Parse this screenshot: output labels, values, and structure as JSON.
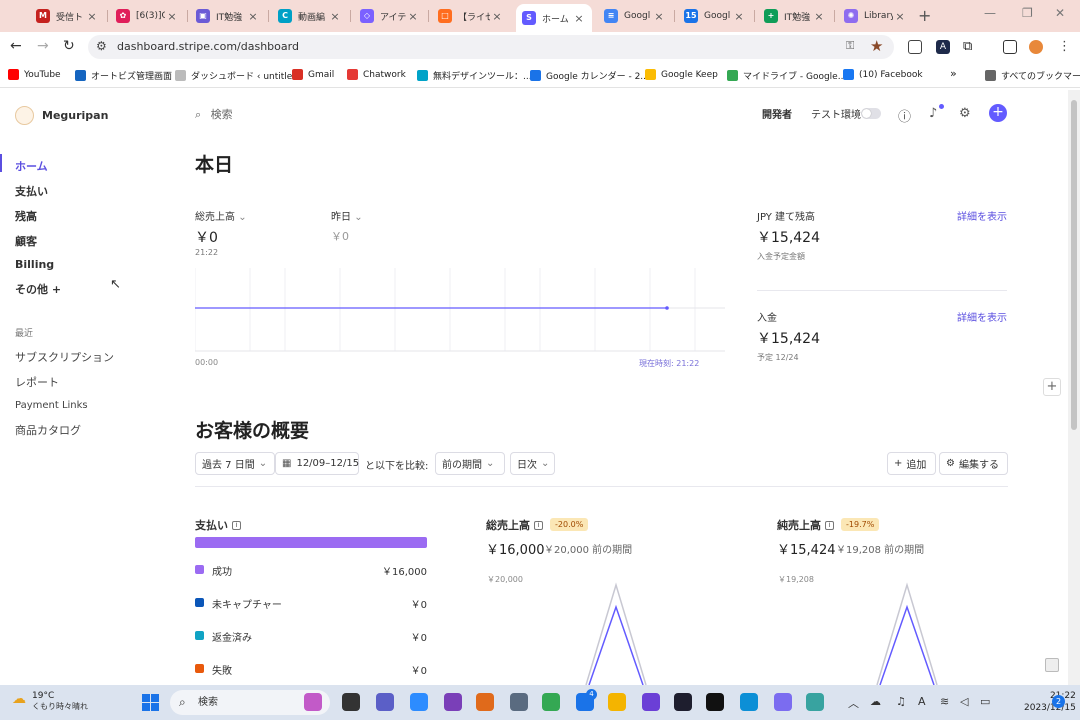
{
  "browser": {
    "tabs": [
      {
        "title": "受信トレ",
        "color": "#c5221f",
        "glyph": "M"
      },
      {
        "title": "[6(3)]C",
        "color": "#e01e5a",
        "glyph": "✿"
      },
      {
        "title": "IT勉強",
        "color": "#6b5bd6",
        "glyph": "▣"
      },
      {
        "title": "動画編",
        "color": "#00a0c6",
        "glyph": "C"
      },
      {
        "title": "アイテム",
        "color": "#7b61ff",
        "glyph": "◇"
      },
      {
        "title": "【ライセ",
        "color": "#ff6d1f",
        "glyph": "□"
      },
      {
        "title": "ホーム -",
        "color": "#635bff",
        "glyph": "S"
      },
      {
        "title": "Googl",
        "color": "#4285f4",
        "glyph": "≡"
      },
      {
        "title": "Googl",
        "color": "#1a73e8",
        "glyph": "15"
      },
      {
        "title": "IT勉強",
        "color": "#0f9d58",
        "glyph": "+"
      },
      {
        "title": "Library",
        "color": "#8e6cef",
        "glyph": "✺"
      }
    ],
    "address": {
      "url": "dashboard.stripe.com/dashboard"
    },
    "bookmarks": [
      {
        "label": "YouTube",
        "color": "#ff0000"
      },
      {
        "label": "オートビズ管理画面",
        "color": "#1565c0"
      },
      {
        "label": "ダッシュボード ‹ untitle...",
        "color": "#bbbbbb"
      },
      {
        "label": "Gmail",
        "color": "#d93025"
      },
      {
        "label": "Chatwork",
        "color": "#e53935"
      },
      {
        "label": "無料デザインツール：...",
        "color": "#00a3c8"
      },
      {
        "label": "Google カレンダー - 2...",
        "color": "#1a73e8"
      },
      {
        "label": "Google Keep",
        "color": "#fbbc04"
      },
      {
        "label": "マイドライブ - Google...",
        "color": "#34a853"
      },
      {
        "label": "(10) Facebook",
        "color": "#1877f2"
      },
      {
        "label": "すべてのブックマーク",
        "color": "#666666"
      }
    ]
  },
  "sidebar": {
    "account": "Meguripan",
    "nav": [
      "ホーム",
      "支払い",
      "残高",
      "顧客",
      "Billing",
      "その他 +"
    ],
    "recent_label": "最近",
    "recent": [
      "サブスクリプション",
      "レポート",
      "Payment Links",
      "商品カタログ"
    ]
  },
  "topbar": {
    "search": "検索",
    "developer": "開発者",
    "test_mode": "テスト環境"
  },
  "today": {
    "title": "本日",
    "gross_label": "総売上高",
    "gross_value": "￥0",
    "gross_time": "21:22",
    "yesterday_label": "昨日",
    "yesterday_value": "￥0",
    "axis_start": "00:00",
    "axis_now": "現在時刻: 21:22",
    "balance_label": "JPY 建て残高",
    "balance_value": "￥15,424",
    "balance_sub": "入金予定金額",
    "balance_link": "詳細を表示",
    "payout_label": "入金",
    "payout_value": "￥15,424",
    "payout_sub": "予定 12/24",
    "payout_link": "詳細を表示"
  },
  "overview": {
    "title": "お客様の概要",
    "range": "過去 7 日間",
    "dates": "12/09–12/15",
    "compare_label": "と以下を比較:",
    "compare": "前の期間",
    "interval": "日次",
    "add": "追加",
    "edit": "編集する"
  },
  "payments_card": {
    "title": "支払い",
    "rows": [
      {
        "label": "成功",
        "value": "￥16,000",
        "color": "#9b6bf2"
      },
      {
        "label": "未キャプチャー",
        "value": "￥0",
        "color": "#0b56b8"
      },
      {
        "label": "返金済み",
        "value": "￥0",
        "color": "#10a3c4"
      },
      {
        "label": "失敗",
        "value": "￥0",
        "color": "#e8590c"
      }
    ]
  },
  "gross_card": {
    "title": "総売上高",
    "badge": "-20.0%",
    "value": "￥16,000",
    "prev": "￥20,000 前の期間",
    "axis_top": "￥20,000"
  },
  "net_card": {
    "title": "純売上高",
    "badge": "-19.7%",
    "value": "￥15,424",
    "prev": "￥19,208 前の期間",
    "axis_top": "￥19,208"
  },
  "taskbar": {
    "temp": "19°C",
    "weather": "くもり時々晴れ",
    "search": "検索",
    "time": "21:22",
    "date": "2023/12/15",
    "notifications": "2",
    "badge": "4"
  },
  "colors": {
    "accent": "#635bff",
    "tabbar": "#f5dcd7",
    "taskbar": "#dbe3ef"
  }
}
